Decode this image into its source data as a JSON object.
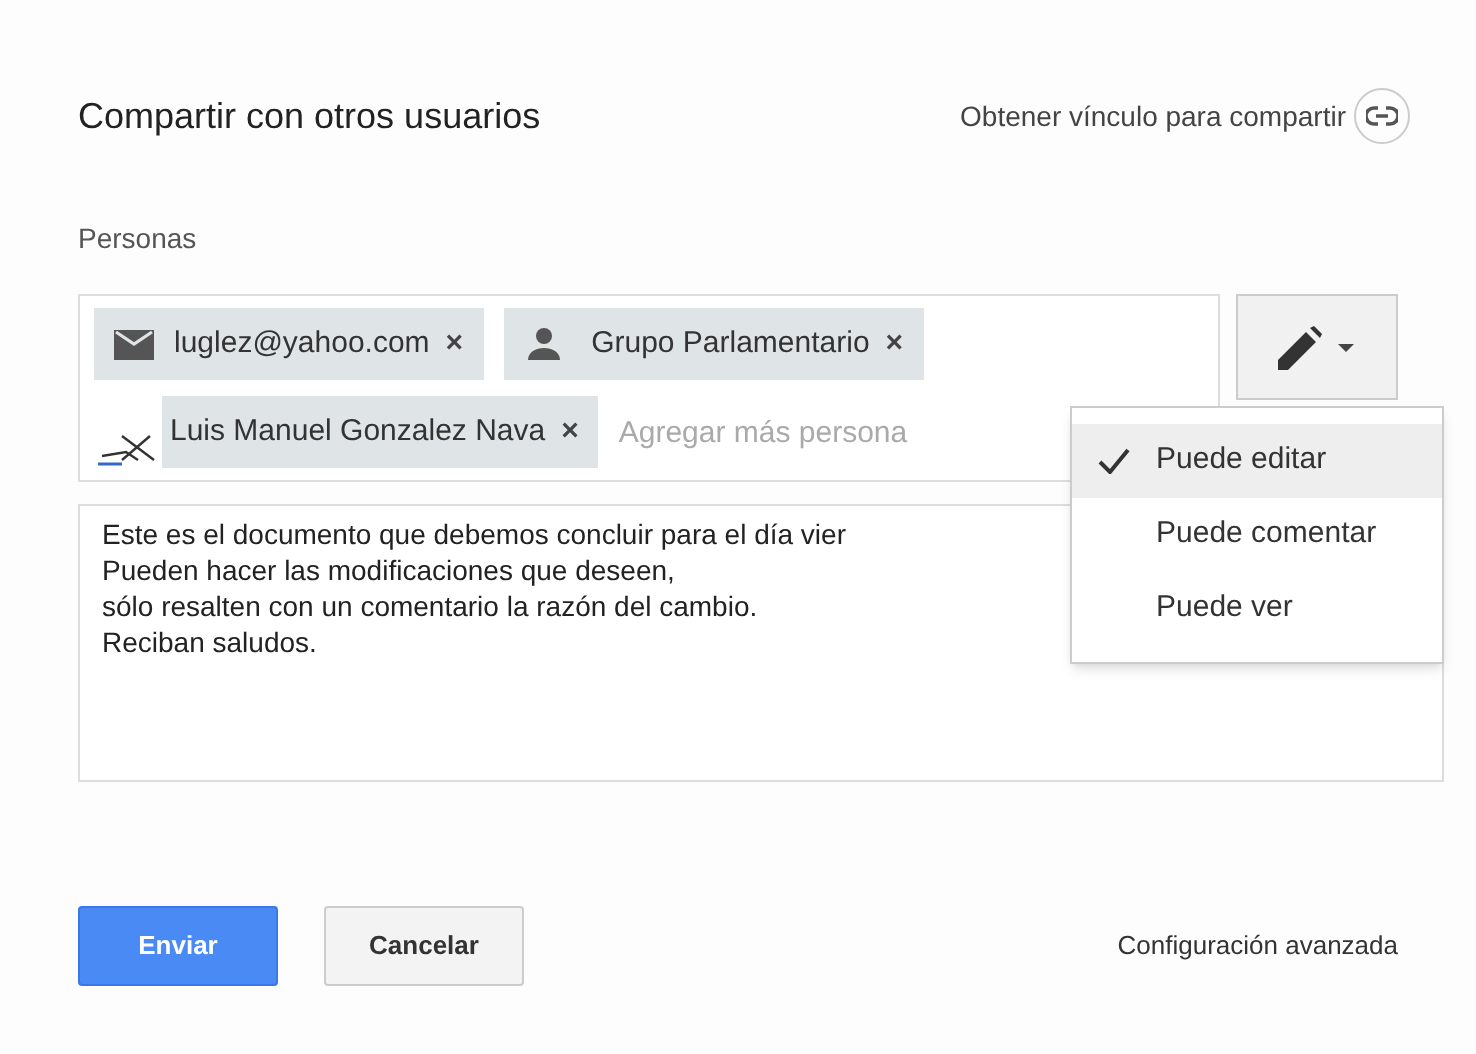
{
  "dialog": {
    "title": "Compartir con otros usuarios",
    "link_text": "Obtener vínculo para compartir"
  },
  "people": {
    "label": "Personas",
    "placeholder": "Agregar más persona",
    "chips": [
      {
        "kind": "email",
        "label": "luglez@yahoo.com",
        "remove": "×"
      },
      {
        "kind": "group",
        "label": "Grupo Parlamentario",
        "remove": "×"
      },
      {
        "kind": "photo",
        "label": "Luis Manuel Gonzalez Nava",
        "remove": "×"
      }
    ]
  },
  "permission_menu": {
    "expanded": true,
    "items": [
      {
        "label": "Puede editar",
        "selected": true
      },
      {
        "label": "Puede comentar",
        "selected": false
      },
      {
        "label": "Puede ver",
        "selected": false
      }
    ]
  },
  "message": {
    "lines": [
      "Este es el documento que debemos concluir para el día vier",
      "Pueden hacer las modificaciones que deseen,",
      "sólo resalten con un comentario la razón del cambio.",
      "Reciban saludos."
    ]
  },
  "buttons": {
    "send": "Enviar",
    "cancel": "Cancelar",
    "advanced": "Configuración avanzada"
  }
}
